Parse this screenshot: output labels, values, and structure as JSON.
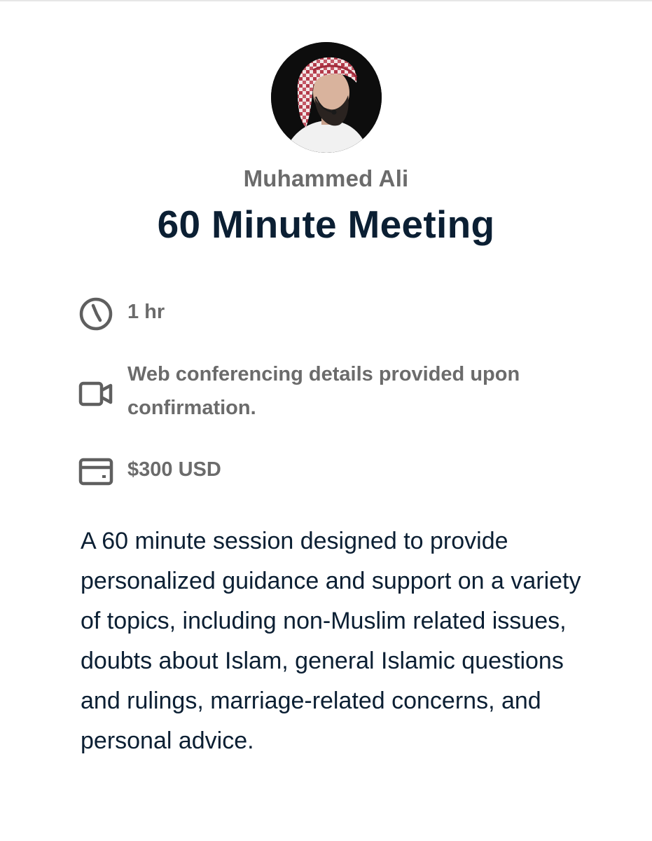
{
  "host": {
    "name": "Muhammed Ali",
    "avatar_icon": "profile-photo"
  },
  "event": {
    "title": "60 Minute Meeting",
    "duration": "1 hr",
    "duration_icon": "clock-icon",
    "location": "Web conferencing details provided upon confirmation.",
    "location_icon": "video-camera-icon",
    "price": "$300 USD",
    "price_icon": "credit-card-icon",
    "description": "A 60 minute session designed to provide personalized guidance and support on a variety of topics, including non-Muslim related issues, doubts about Islam, general Islamic questions and rulings, marriage-related concerns, and personal advice."
  },
  "colors": {
    "title": "#0b1f33",
    "muted": "#6b6b6b",
    "icon": "#5f5f5f"
  }
}
